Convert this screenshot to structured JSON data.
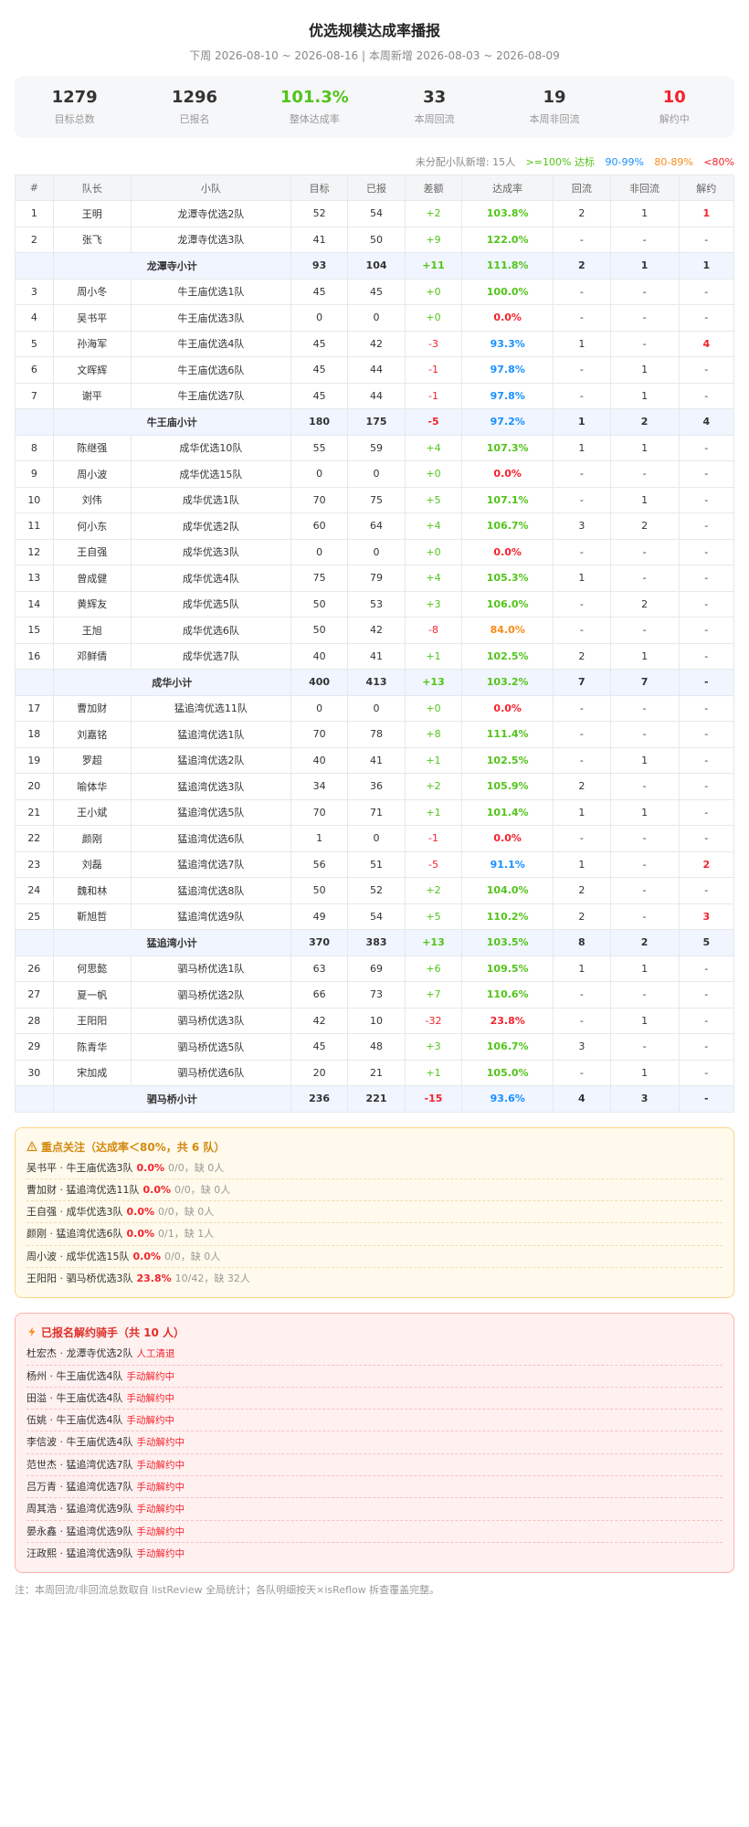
{
  "header": {
    "title": "优选规模达成率播报",
    "subtitle": "下周 2026-08-10 ~ 2026-08-16 | 本周新增 2026-08-03 ~ 2026-08-09"
  },
  "stats": [
    {
      "value": "1279",
      "label": "目标总数",
      "color": "#333333"
    },
    {
      "value": "1296",
      "label": "已报名",
      "color": "#333333"
    },
    {
      "value": "101.3%",
      "label": "整体达成率",
      "color": "#52c41a"
    },
    {
      "value": "33",
      "label": "本周回流",
      "color": "#333333"
    },
    {
      "value": "19",
      "label": "本周非回流",
      "color": "#333333"
    },
    {
      "value": "10",
      "label": "解约中",
      "color": "#f5222d"
    }
  ],
  "legend": {
    "unassigned": "未分配小队新增: 15人",
    "green": ">=100% 达标",
    "blue": "90-99%",
    "orange": "80-89%",
    "red": "<80%"
  },
  "colors": {
    "green": "#52c41a",
    "blue": "#1890ff",
    "orange": "#fa8c16",
    "red": "#f5222d"
  },
  "table": {
    "headers": [
      "#",
      "队长",
      "小队",
      "目标",
      "已报",
      "差额",
      "达成率",
      "回流",
      "非回流",
      "解约"
    ],
    "rows": [
      {
        "type": "row",
        "no": "1",
        "captain": "王明",
        "team": "龙潭寺优选2队",
        "target": "52",
        "signed": "54",
        "diff": "+2",
        "rate": "103.8%",
        "rc": "green",
        "back": "2",
        "nonback": "1",
        "cancel": "1"
      },
      {
        "type": "row",
        "no": "2",
        "captain": "张飞",
        "team": "龙潭寺优选3队",
        "target": "41",
        "signed": "50",
        "diff": "+9",
        "rate": "122.0%",
        "rc": "green",
        "back": "-",
        "nonback": "-",
        "cancel": "-"
      },
      {
        "type": "sub",
        "label": "龙潭寺小计",
        "target": "93",
        "signed": "104",
        "diff": "+11",
        "rate": "111.8%",
        "rc": "green",
        "back": "2",
        "nonback": "1",
        "cancel": "1"
      },
      {
        "type": "row",
        "no": "3",
        "captain": "周小冬",
        "team": "牛王庙优选1队",
        "target": "45",
        "signed": "45",
        "diff": "+0",
        "rate": "100.0%",
        "rc": "green",
        "back": "-",
        "nonback": "-",
        "cancel": "-"
      },
      {
        "type": "row",
        "no": "4",
        "captain": "吴书平",
        "team": "牛王庙优选3队",
        "target": "0",
        "signed": "0",
        "diff": "+0",
        "rate": "0.0%",
        "rc": "red",
        "back": "-",
        "nonback": "-",
        "cancel": "-"
      },
      {
        "type": "row",
        "no": "5",
        "captain": "孙海军",
        "team": "牛王庙优选4队",
        "target": "45",
        "signed": "42",
        "diff": "-3",
        "rate": "93.3%",
        "rc": "blue",
        "back": "1",
        "nonback": "-",
        "cancel": "4"
      },
      {
        "type": "row",
        "no": "6",
        "captain": "文晖辉",
        "team": "牛王庙优选6队",
        "target": "45",
        "signed": "44",
        "diff": "-1",
        "rate": "97.8%",
        "rc": "blue",
        "back": "-",
        "nonback": "1",
        "cancel": "-"
      },
      {
        "type": "row",
        "no": "7",
        "captain": "谢平",
        "team": "牛王庙优选7队",
        "target": "45",
        "signed": "44",
        "diff": "-1",
        "rate": "97.8%",
        "rc": "blue",
        "back": "-",
        "nonback": "1",
        "cancel": "-"
      },
      {
        "type": "sub",
        "label": "牛王庙小计",
        "target": "180",
        "signed": "175",
        "diff": "-5",
        "rate": "97.2%",
        "rc": "blue",
        "back": "1",
        "nonback": "2",
        "cancel": "4"
      },
      {
        "type": "row",
        "no": "8",
        "captain": "陈继强",
        "team": "成华优选10队",
        "target": "55",
        "signed": "59",
        "diff": "+4",
        "rate": "107.3%",
        "rc": "green",
        "back": "1",
        "nonback": "1",
        "cancel": "-"
      },
      {
        "type": "row",
        "no": "9",
        "captain": "周小波",
        "team": "成华优选15队",
        "target": "0",
        "signed": "0",
        "diff": "+0",
        "rate": "0.0%",
        "rc": "red",
        "back": "-",
        "nonback": "-",
        "cancel": "-"
      },
      {
        "type": "row",
        "no": "10",
        "captain": "刘伟",
        "team": "成华优选1队",
        "target": "70",
        "signed": "75",
        "diff": "+5",
        "rate": "107.1%",
        "rc": "green",
        "back": "-",
        "nonback": "1",
        "cancel": "-"
      },
      {
        "type": "row",
        "no": "11",
        "captain": "何小东",
        "team": "成华优选2队",
        "target": "60",
        "signed": "64",
        "diff": "+4",
        "rate": "106.7%",
        "rc": "green",
        "back": "3",
        "nonback": "2",
        "cancel": "-"
      },
      {
        "type": "row",
        "no": "12",
        "captain": "王自强",
        "team": "成华优选3队",
        "target": "0",
        "signed": "0",
        "diff": "+0",
        "rate": "0.0%",
        "rc": "red",
        "back": "-",
        "nonback": "-",
        "cancel": "-"
      },
      {
        "type": "row",
        "no": "13",
        "captain": "曾成健",
        "team": "成华优选4队",
        "target": "75",
        "signed": "79",
        "diff": "+4",
        "rate": "105.3%",
        "rc": "green",
        "back": "1",
        "nonback": "-",
        "cancel": "-"
      },
      {
        "type": "row",
        "no": "14",
        "captain": "黄辉友",
        "team": "成华优选5队",
        "target": "50",
        "signed": "53",
        "diff": "+3",
        "rate": "106.0%",
        "rc": "green",
        "back": "-",
        "nonback": "2",
        "cancel": "-"
      },
      {
        "type": "row",
        "no": "15",
        "captain": "王旭",
        "team": "成华优选6队",
        "target": "50",
        "signed": "42",
        "diff": "-8",
        "rate": "84.0%",
        "rc": "orange",
        "back": "-",
        "nonback": "-",
        "cancel": "-"
      },
      {
        "type": "row",
        "no": "16",
        "captain": "邓鲜倩",
        "team": "成华优选7队",
        "target": "40",
        "signed": "41",
        "diff": "+1",
        "rate": "102.5%",
        "rc": "green",
        "back": "2",
        "nonback": "1",
        "cancel": "-"
      },
      {
        "type": "sub",
        "label": "成华小计",
        "target": "400",
        "signed": "413",
        "diff": "+13",
        "rate": "103.2%",
        "rc": "green",
        "back": "7",
        "nonback": "7",
        "cancel": "-"
      },
      {
        "type": "row",
        "no": "17",
        "captain": "曹加财",
        "team": "猛追湾优选11队",
        "target": "0",
        "signed": "0",
        "diff": "+0",
        "rate": "0.0%",
        "rc": "red",
        "back": "-",
        "nonback": "-",
        "cancel": "-"
      },
      {
        "type": "row",
        "no": "18",
        "captain": "刘嘉铭",
        "team": "猛追湾优选1队",
        "target": "70",
        "signed": "78",
        "diff": "+8",
        "rate": "111.4%",
        "rc": "green",
        "back": "-",
        "nonback": "-",
        "cancel": "-"
      },
      {
        "type": "row",
        "no": "19",
        "captain": "罗超",
        "team": "猛追湾优选2队",
        "target": "40",
        "signed": "41",
        "diff": "+1",
        "rate": "102.5%",
        "rc": "green",
        "back": "-",
        "nonback": "1",
        "cancel": "-"
      },
      {
        "type": "row",
        "no": "20",
        "captain": "喻体华",
        "team": "猛追湾优选3队",
        "target": "34",
        "signed": "36",
        "diff": "+2",
        "rate": "105.9%",
        "rc": "green",
        "back": "2",
        "nonback": "-",
        "cancel": "-"
      },
      {
        "type": "row",
        "no": "21",
        "captain": "王小斌",
        "team": "猛追湾优选5队",
        "target": "70",
        "signed": "71",
        "diff": "+1",
        "rate": "101.4%",
        "rc": "green",
        "back": "1",
        "nonback": "1",
        "cancel": "-"
      },
      {
        "type": "row",
        "no": "22",
        "captain": "颜刚",
        "team": "猛追湾优选6队",
        "target": "1",
        "signed": "0",
        "diff": "-1",
        "rate": "0.0%",
        "rc": "red",
        "back": "-",
        "nonback": "-",
        "cancel": "-"
      },
      {
        "type": "row",
        "no": "23",
        "captain": "刘磊",
        "team": "猛追湾优选7队",
        "target": "56",
        "signed": "51",
        "diff": "-5",
        "rate": "91.1%",
        "rc": "blue",
        "back": "1",
        "nonback": "-",
        "cancel": "2"
      },
      {
        "type": "row",
        "no": "24",
        "captain": "魏和林",
        "team": "猛追湾优选8队",
        "target": "50",
        "signed": "52",
        "diff": "+2",
        "rate": "104.0%",
        "rc": "green",
        "back": "2",
        "nonback": "-",
        "cancel": "-"
      },
      {
        "type": "row",
        "no": "25",
        "captain": "靳旭哲",
        "team": "猛追湾优选9队",
        "target": "49",
        "signed": "54",
        "diff": "+5",
        "rate": "110.2%",
        "rc": "green",
        "back": "2",
        "nonback": "-",
        "cancel": "3"
      },
      {
        "type": "sub",
        "label": "猛追湾小计",
        "target": "370",
        "signed": "383",
        "diff": "+13",
        "rate": "103.5%",
        "rc": "green",
        "back": "8",
        "nonback": "2",
        "cancel": "5"
      },
      {
        "type": "row",
        "no": "26",
        "captain": "何思懿",
        "team": "驷马桥优选1队",
        "target": "63",
        "signed": "69",
        "diff": "+6",
        "rate": "109.5%",
        "rc": "green",
        "back": "1",
        "nonback": "1",
        "cancel": "-"
      },
      {
        "type": "row",
        "no": "27",
        "captain": "夏一帆",
        "team": "驷马桥优选2队",
        "target": "66",
        "signed": "73",
        "diff": "+7",
        "rate": "110.6%",
        "rc": "green",
        "back": "-",
        "nonback": "-",
        "cancel": "-"
      },
      {
        "type": "row",
        "no": "28",
        "captain": "王阳阳",
        "team": "驷马桥优选3队",
        "target": "42",
        "signed": "10",
        "diff": "-32",
        "rate": "23.8%",
        "rc": "red",
        "back": "-",
        "nonback": "1",
        "cancel": "-"
      },
      {
        "type": "row",
        "no": "29",
        "captain": "陈青华",
        "team": "驷马桥优选5队",
        "target": "45",
        "signed": "48",
        "diff": "+3",
        "rate": "106.7%",
        "rc": "green",
        "back": "3",
        "nonback": "-",
        "cancel": "-"
      },
      {
        "type": "row",
        "no": "30",
        "captain": "宋加成",
        "team": "驷马桥优选6队",
        "target": "20",
        "signed": "21",
        "diff": "+1",
        "rate": "105.0%",
        "rc": "green",
        "back": "-",
        "nonback": "1",
        "cancel": "-"
      },
      {
        "type": "sub",
        "label": "驷马桥小计",
        "target": "236",
        "signed": "221",
        "diff": "-15",
        "rate": "93.6%",
        "rc": "blue",
        "back": "4",
        "nonback": "3",
        "cancel": "-"
      }
    ]
  },
  "focus": {
    "title": "重点关注（达成率＜80%，共 6 队）",
    "icon": "warning-icon",
    "items": [
      {
        "name": "吴书平 · 牛王庙优选3队",
        "pct": "0.0%",
        "meta": "0/0，缺 0人"
      },
      {
        "name": "曹加财 · 猛追湾优选11队",
        "pct": "0.0%",
        "meta": "0/0，缺 0人"
      },
      {
        "name": "王自强 · 成华优选3队",
        "pct": "0.0%",
        "meta": "0/0，缺 0人"
      },
      {
        "name": "颜刚 · 猛追湾优选6队",
        "pct": "0.0%",
        "meta": "0/1，缺 1人"
      },
      {
        "name": "周小波 · 成华优选15队",
        "pct": "0.0%",
        "meta": "0/0，缺 0人"
      },
      {
        "name": "王阳阳 · 驷马桥优选3队",
        "pct": "23.8%",
        "meta": "10/42，缺 32人"
      }
    ]
  },
  "cancels": {
    "title": "已报名解约骑手（共 10 人）",
    "icon": "lightning-icon",
    "items": [
      {
        "name": "杜宏杰 · 龙潭寺优选2队",
        "status": "人工清退"
      },
      {
        "name": "杨州 · 牛王庙优选4队",
        "status": "手动解约中"
      },
      {
        "name": "田溢 · 牛王庙优选4队",
        "status": "手动解约中"
      },
      {
        "name": "伍姚 · 牛王庙优选4队",
        "status": "手动解约中"
      },
      {
        "name": "李信波 · 牛王庙优选4队",
        "status": "手动解约中"
      },
      {
        "name": "范世杰 · 猛追湾优选7队",
        "status": "手动解约中"
      },
      {
        "name": "吕万青 · 猛追湾优选7队",
        "status": "手动解约中"
      },
      {
        "name": "周其浩 · 猛追湾优选9队",
        "status": "手动解约中"
      },
      {
        "name": "晏永鑫 · 猛追湾优选9队",
        "status": "手动解约中"
      },
      {
        "name": "汪政熙 · 猛追湾优选9队",
        "status": "手动解约中"
      }
    ]
  },
  "footnote": "注：本周回流/非回流总数取自 listReview 全局统计；各队明细按天×isReflow 拆查覆盖完整。"
}
